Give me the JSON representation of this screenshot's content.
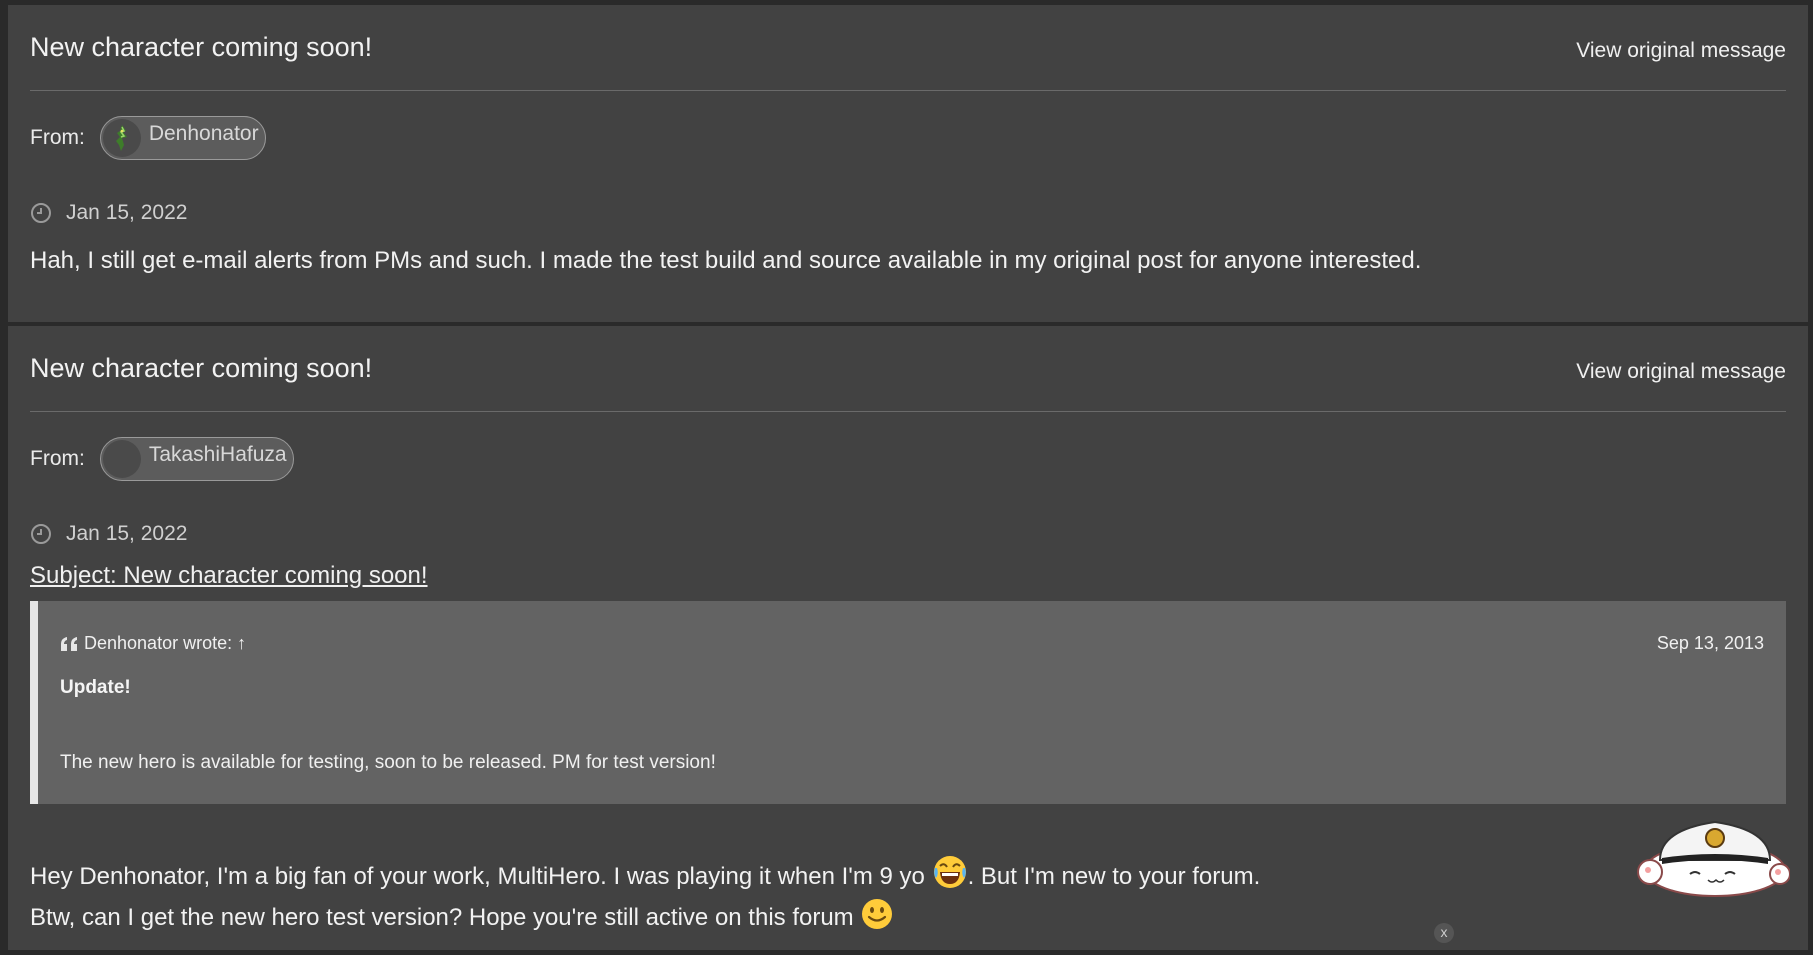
{
  "messages": [
    {
      "title": "New character coming soon!",
      "view_original": "View original message",
      "from_label": "From:",
      "author": "Denhonator",
      "date": "Jan 15, 2022",
      "body": "Hah, I still get e-mail alerts from PMs and such. I made the test build and source available in my original post for anyone interested."
    },
    {
      "title": "New character coming soon!",
      "view_original": "View original message",
      "from_label": "From:",
      "author": "TakashiHafuza",
      "date": "Jan 15, 2022",
      "subject": "Subject: New character coming soon!",
      "quote": {
        "author_line": "Denhonator wrote:",
        "arrow": "↑",
        "date": "Sep 13, 2013",
        "heading": "Update!",
        "text": "The new hero is available for testing, soon to be released. PM for test version!"
      },
      "body_line1_a": "Hey Denhonator, I'm a big fan of your work, MultiHero. I was playing it when I'm 9 yo",
      "body_line1_b": ". But I'm new to your forum.",
      "body_line2": "Btw, can I get the new hero test version? Hope you're still active on this forum"
    }
  ],
  "overlay": {
    "close_label": "x"
  },
  "icons": [
    "clock-icon",
    "quote-icon",
    "laughing-emoji-icon",
    "smile-emoji-icon",
    "avatar-image",
    "sticker-image"
  ]
}
